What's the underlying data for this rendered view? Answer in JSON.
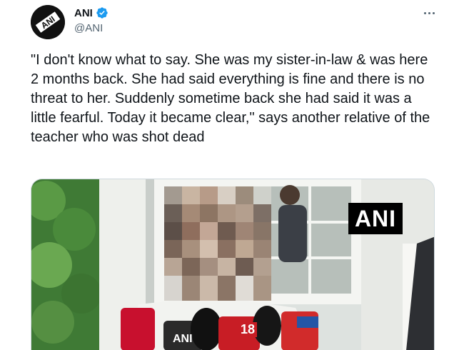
{
  "author": {
    "display_name": "ANI",
    "handle": "@ANI",
    "verified": true,
    "avatar_text": "ANI"
  },
  "tweet": {
    "text": "\"I don't know what to say. She was my sister-in-law & was here 2 months back. She had said everything is fine and there is no threat to her. Suddenly sometime back she had said it was a little fearful. Today it became clear,\" says another relative of the teacher who was shot dead"
  },
  "media": {
    "watermark": "ANI",
    "mic_labels": [
      "18",
      "ANI"
    ]
  },
  "colors": {
    "text_primary": "#0f1419",
    "text_secondary": "#536471",
    "verified_blue": "#1d9bf0",
    "border": "#cfd9de"
  },
  "icons": {
    "verified": "verified-badge-icon",
    "more": "more-dots-icon"
  }
}
